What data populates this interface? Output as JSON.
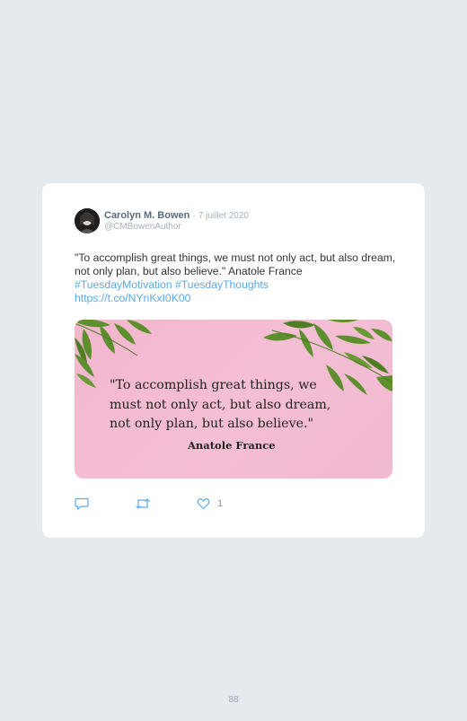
{
  "tweet": {
    "author_name": "Carolyn M. Bowen",
    "separator": "·",
    "date": "7 juillet 2020",
    "handle": "@CMBowenAuthor",
    "text_main": "\"To accomplish great things, we must not only act, but also dream, not only plan, but also believe.\" Anatole France",
    "hashtag_1": "#TuesdayMotivation",
    "hashtag_2": "#TuesdayThoughts",
    "link": "https://t.co/NYnKxI0K00",
    "like_count": "1"
  },
  "media": {
    "quote_line_1": "\"To accomplish great things, we",
    "quote_line_2": "must not only act, but also dream,",
    "quote_line_3": "not only plan, but also believe.\"",
    "quote_author": "Anatole France"
  },
  "icons": [
    "reply-icon",
    "retweet-icon",
    "like-icon"
  ],
  "colors": {
    "background": "#e6e9ee",
    "card": "#ffffff",
    "link": "#5aa9e6",
    "name": "#5b6b7d",
    "media_pink": "#f4bed5",
    "leaf_green": "#5e8f2e"
  },
  "page_number": "88"
}
